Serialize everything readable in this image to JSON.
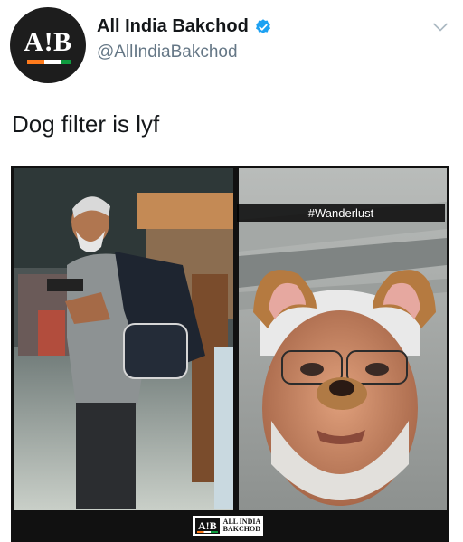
{
  "account": {
    "display_name": "All India Bakchod",
    "handle": "@AllIndiaBakchod",
    "avatar_logo": "A!B",
    "verified": true,
    "verified_color": "#1da1f2"
  },
  "tweet": {
    "text": "Dog filter is lyf"
  },
  "media": {
    "caption": "#Wanderlust",
    "watermark_logo": "A!B",
    "watermark_text": "ALL INDIA\nBAKCHOD"
  },
  "icons": {
    "menu": "chevron-down-icon",
    "verified": "verified-badge-icon"
  }
}
